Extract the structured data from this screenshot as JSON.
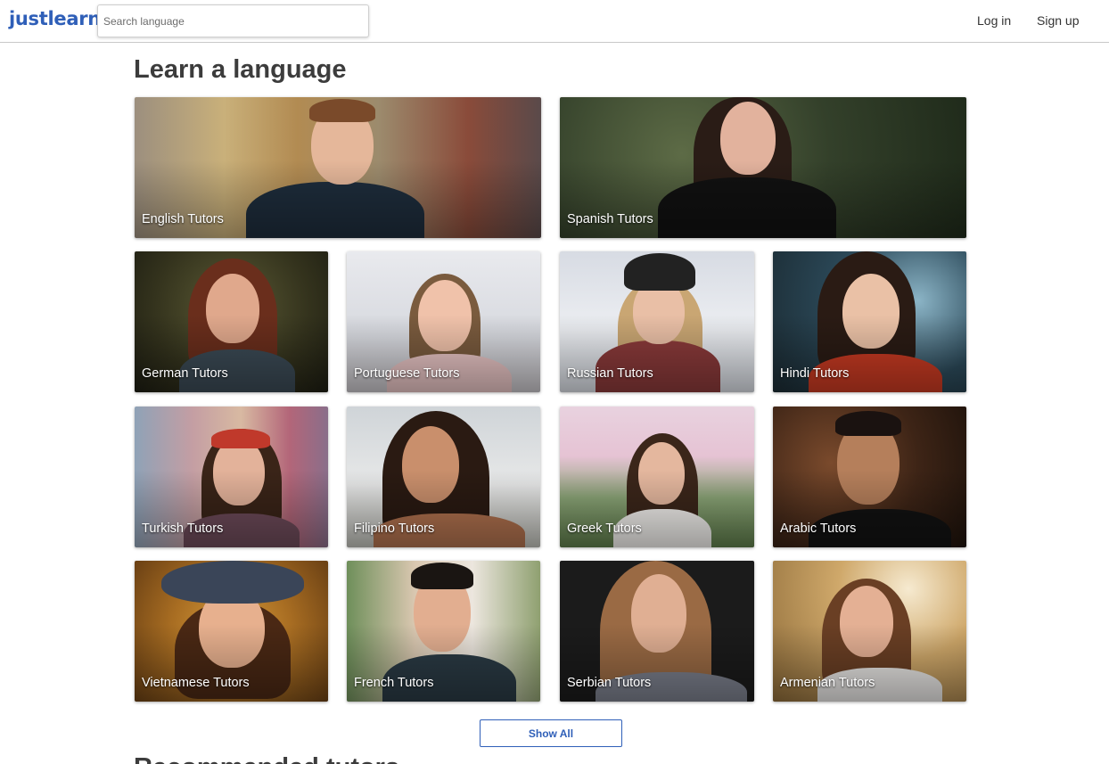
{
  "header": {
    "logo": "justlearn",
    "search_placeholder": "Search language",
    "login_label": "Log in",
    "signup_label": "Sign up"
  },
  "main": {
    "title": "Learn a language",
    "cards": [
      {
        "label": "English Tutors"
      },
      {
        "label": "Spanish Tutors"
      },
      {
        "label": "German Tutors"
      },
      {
        "label": "Portuguese Tutors"
      },
      {
        "label": "Russian Tutors"
      },
      {
        "label": "Hindi Tutors"
      },
      {
        "label": "Turkish Tutors"
      },
      {
        "label": "Filipino Tutors"
      },
      {
        "label": "Greek Tutors"
      },
      {
        "label": "Arabic Tutors"
      },
      {
        "label": "Vietnamese Tutors"
      },
      {
        "label": "French Tutors"
      },
      {
        "label": "Serbian Tutors"
      },
      {
        "label": "Armenian Tutors"
      }
    ],
    "show_all_label": "Show All",
    "next_section_title": "Recommended tutors"
  },
  "colors": {
    "brand": "#2f5fb8",
    "header_border": "#c9c9c9",
    "card_label": "#ffffff"
  }
}
